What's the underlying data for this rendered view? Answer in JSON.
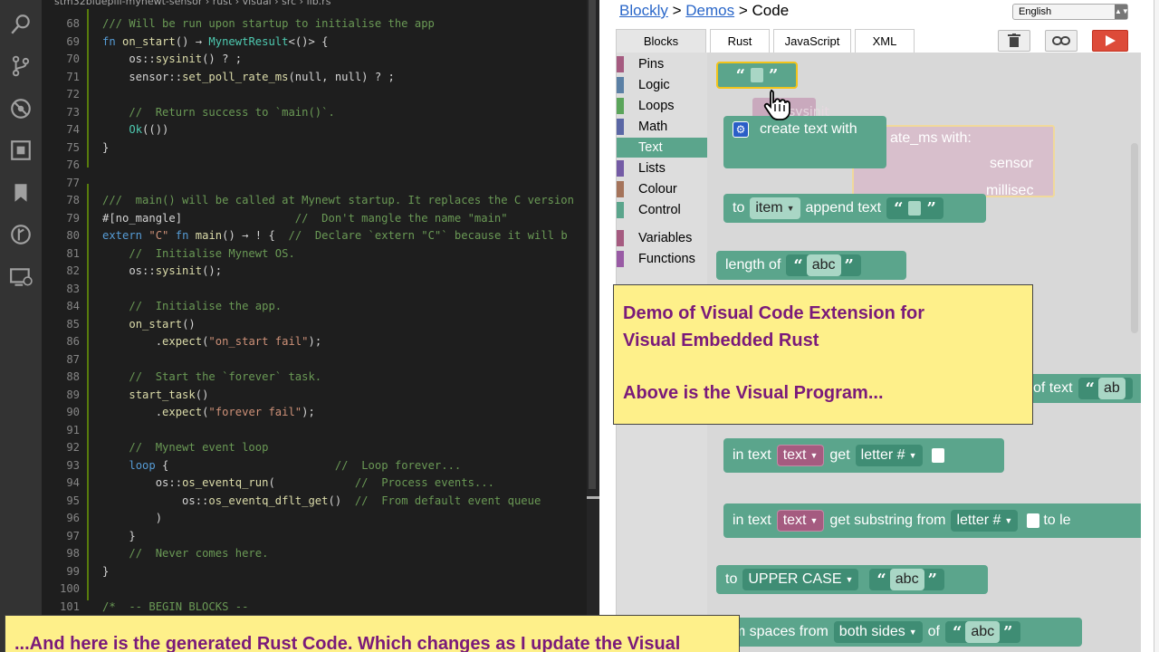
{
  "breadcrumb": {
    "path": "stm32bluepill-mynewt-sensor  ›  rust  ›  visual  ›  src  ›  lib.rs"
  },
  "code": {
    "lines": [
      {
        "n": "68",
        "html": "<span class=\"c\">/// Will be run upon startup to initialise the app</span>"
      },
      {
        "n": "69",
        "html": "<span class=\"k\">fn</span> <span class=\"f\">on_start</span>() → <span class=\"t\">MynewtResult</span>&lt;()&gt; {"
      },
      {
        "n": "70",
        "html": "    os::<span class=\"f\">sysinit</span>() ? ;"
      },
      {
        "n": "71",
        "html": "    sensor::<span class=\"f\">set_poll_rate_ms</span>(null, null) ? ;"
      },
      {
        "n": "72",
        "html": ""
      },
      {
        "n": "73",
        "html": "    <span class=\"c\">//  Return success to `main()`.</span>"
      },
      {
        "n": "74",
        "html": "    <span class=\"t\">Ok</span>(())"
      },
      {
        "n": "75",
        "html": "}"
      },
      {
        "n": "76",
        "html": ""
      },
      {
        "n": "77",
        "html": ""
      },
      {
        "n": "78",
        "html": "<span class=\"c\">///  main() will be called at Mynewt startup. It replaces the C version</span>"
      },
      {
        "n": "79",
        "html": "#[no_mangle]                 <span class=\"c\">//  Don't mangle the name \"main\"</span>"
      },
      {
        "n": "80",
        "html": "<span class=\"k\">extern</span> <span class=\"s\">\"C\"</span> <span class=\"k\">fn</span> <span class=\"f\">main</span>() → ! {  <span class=\"c\">//  Declare `extern \"C\"` because it will b</span>"
      },
      {
        "n": "81",
        "html": "    <span class=\"c\">//  Initialise Mynewt OS.</span>"
      },
      {
        "n": "82",
        "html": "    os::<span class=\"f\">sysinit</span>();"
      },
      {
        "n": "83",
        "html": ""
      },
      {
        "n": "84",
        "html": "    <span class=\"c\">//  Initialise the app.</span>"
      },
      {
        "n": "85",
        "html": "    <span class=\"f\">on_start</span>()"
      },
      {
        "n": "86",
        "html": "        .<span class=\"f\">expect</span>(<span class=\"s\">\"on_start fail\"</span>);"
      },
      {
        "n": "87",
        "html": ""
      },
      {
        "n": "88",
        "html": "    <span class=\"c\">//  Start the `forever` task.</span>"
      },
      {
        "n": "89",
        "html": "    <span class=\"f\">start_task</span>()"
      },
      {
        "n": "90",
        "html": "        .<span class=\"f\">expect</span>(<span class=\"s\">\"forever fail\"</span>);"
      },
      {
        "n": "91",
        "html": ""
      },
      {
        "n": "92",
        "html": "    <span class=\"c\">//  Mynewt event loop</span>"
      },
      {
        "n": "93",
        "html": "    <span class=\"k\">loop</span> {                         <span class=\"c\">//  Loop forever...</span>"
      },
      {
        "n": "94",
        "html": "        os::<span class=\"f\">os_eventq_run</span>(            <span class=\"c\">//  Process events...</span>"
      },
      {
        "n": "95",
        "html": "            os::<span class=\"f\">os_eventq_dflt_get</span>()  <span class=\"c\">//  From default event queue</span>"
      },
      {
        "n": "96",
        "html": "        )"
      },
      {
        "n": "97",
        "html": "    }"
      },
      {
        "n": "98",
        "html": "    <span class=\"c\">//  Never comes here.</span>"
      },
      {
        "n": "99",
        "html": "}"
      },
      {
        "n": "100",
        "html": ""
      },
      {
        "n": "101",
        "html": "<span class=\"c\">/*  -- BEGIN BLOCKS --</span>"
      }
    ]
  },
  "blockly": {
    "link_blockly": "Blockly",
    "sep1": ">",
    "link_demos": "Demos",
    "sep2": "> Code",
    "language": "English",
    "tabs": [
      "Blocks",
      "Rust",
      "JavaScript",
      "XML"
    ],
    "toolbox": [
      "Pins",
      "Logic",
      "Loops",
      "Math",
      "Text",
      "Lists",
      "Colour",
      "Control",
      "Variables",
      "Functions"
    ],
    "toolbox_colors": [
      "#a55b80",
      "#5b80a5",
      "#5ba55b",
      "#5b67a5",
      "#5ba58c",
      "#745ba5",
      "#a5745b",
      "#5ba58c",
      "#a55b80",
      "#995ba5"
    ],
    "blocks": {
      "create_text": "create text with",
      "ghost_sysinit": "sysinit",
      "ghost_poll": "ate_ms  with:",
      "ghost_sensor": "sensor",
      "ghost_millisec": "millisec",
      "to": "to",
      "item": "item",
      "append_text": "append text",
      "length_of": "length of",
      "abc": "abc",
      "of_text": "of text",
      "ab": "ab",
      "in_text": "in text",
      "text": "text",
      "get": "get",
      "letter": "letter #",
      "get_substring": "get substring from",
      "to_le": "to  le",
      "upper": "UPPER CASE",
      "trim_prefix": "rim spaces from",
      "both_sides": "both sides",
      "of": "of"
    }
  },
  "notes": {
    "top_line1": "Demo of Visual Code Extension for",
    "top_line2": "Visual Embedded Rust",
    "top_line3": "Above is the Visual Program...",
    "bottom": "...And here is the generated Rust Code. Which changes as I update the Visual"
  }
}
